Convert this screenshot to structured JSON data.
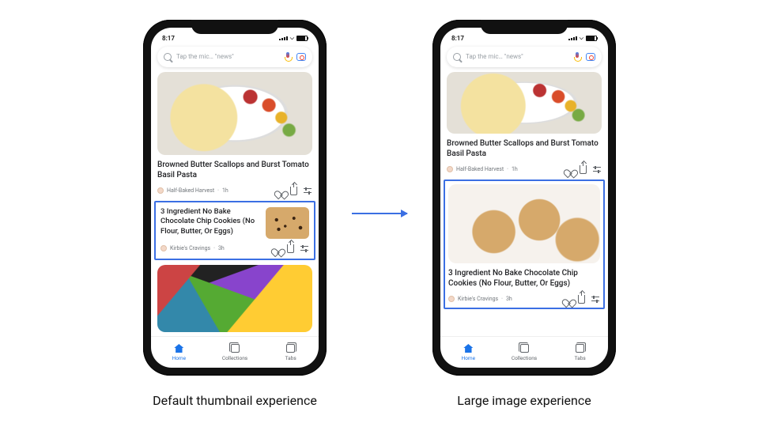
{
  "captions": {
    "left": "Default thumbnail experience",
    "right": "Large image experience"
  },
  "status": {
    "time": "8:17"
  },
  "search": {
    "placeholder": "Tap the mic… \"news\""
  },
  "cards": {
    "pasta": {
      "title": "Browned Butter Scallops and Burst Tomato Basil Pasta",
      "source": "Half-Baked Harvest",
      "age": "1h"
    },
    "cookies": {
      "title": "3 Ingredient No Bake Chocolate Chip Cookies (No Flour, Butter, Or Eggs)",
      "source": "Kirbie's Cravings",
      "age": "3h"
    }
  },
  "tabs": {
    "home": "Home",
    "collections": "Collections",
    "tabs": "Tabs"
  }
}
